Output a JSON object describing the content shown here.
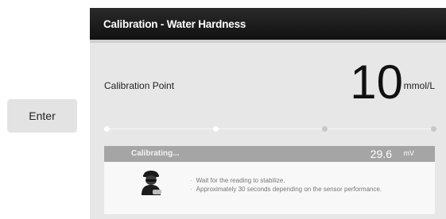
{
  "enter_button": {
    "label": "Enter"
  },
  "panel": {
    "title": "Calibration - Water Hardness",
    "calibration": {
      "label": "Calibration Point",
      "value": "10",
      "unit": "mmol/L"
    },
    "steps": {
      "total": 4,
      "completed": 2
    },
    "status": {
      "text": "Calibrating...",
      "reading": "29.6",
      "reading_unit": "mV",
      "instructions": [
        "Wait for the reading to stabilize.",
        "Approximately 30 seconds depending on the sensor performance."
      ],
      "icon": "operator-icon"
    }
  }
}
